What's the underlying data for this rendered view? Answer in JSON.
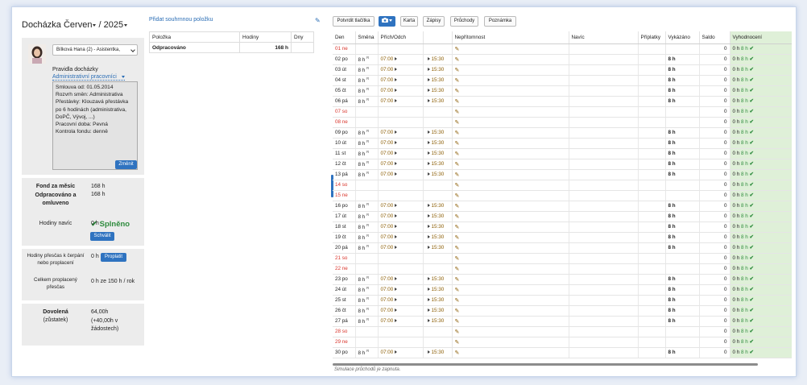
{
  "header": {
    "title": "Docházka Červen",
    "separator": "/",
    "year": "2025"
  },
  "employee": {
    "selected": "Bílková Hana (2) - Asistentka,",
    "rules_label": "Pravidla docházky",
    "rules_value": "Administrativní pracovníci",
    "info_lines": [
      "Smlouva od: 01.05.2014",
      "Rozvrh směn: Administrativa",
      "Přestávky: Klouzavá přestávka po 6 hodinách (administrativa, DoPČ, Vývoj, ...)",
      "Pracovní doba: Pevná",
      "Kontrola fondu: denně"
    ],
    "change_button": "Změnit"
  },
  "fund": {
    "fund_label": "Fond za měsíc",
    "fund_value": "168 h",
    "worked_label": "Odpracováno a omluveno",
    "worked_value": "168 h",
    "status": "Splněno",
    "extra_label": "Hodiny navíc",
    "extra_value": "0 h",
    "approve_button": "Schválit"
  },
  "overtime": {
    "label": "Hodiny přesčas k čerpání nebo proplacení",
    "value": "0 h",
    "pay_button": "Proplatit",
    "total_label": "Celkem proplacený přesčas",
    "total_value": "0 h ze 150 h / rok"
  },
  "vacation": {
    "label": "Dovolená",
    "sublabel": "(zůstatek)",
    "value": "64,00h",
    "pending": "(+40,00h v žádostech)"
  },
  "summary": {
    "add_link": "Přidat souhrnnou položku",
    "columns": [
      "Položka",
      "Hodiny",
      "Dny"
    ],
    "rows": [
      {
        "item": "Odpracováno",
        "hours": "168 h",
        "days": ""
      }
    ]
  },
  "toolbar": {
    "confirm": "Potvrdit tlačítka",
    "karta": "Karta",
    "zapisy": "Zápisy",
    "pruchody": "Průchody",
    "poznamka": "Poznámka"
  },
  "grid": {
    "columns": [
      "Den",
      "Směna",
      "Přích/Odch",
      "Nepřítomnost",
      "Navíc",
      "Příplatky",
      "Vykázáno",
      "Saldo",
      "Vyhodnocení"
    ],
    "shift_mark": "R",
    "arrival": "07:00",
    "departure": "15:30",
    "shift_hours": "8 h",
    "reported": "8 h",
    "saldo": "0",
    "eval_hours": "0 h",
    "eval_ok": "8 h",
    "days": [
      {
        "d": "01",
        "w": "ne",
        "we": true
      },
      {
        "d": "02",
        "w": "po",
        "we": false
      },
      {
        "d": "03",
        "w": "út",
        "we": false
      },
      {
        "d": "04",
        "w": "st",
        "we": false
      },
      {
        "d": "05",
        "w": "čt",
        "we": false
      },
      {
        "d": "06",
        "w": "pá",
        "we": false
      },
      {
        "d": "07",
        "w": "so",
        "we": true
      },
      {
        "d": "08",
        "w": "ne",
        "we": true
      },
      {
        "d": "09",
        "w": "po",
        "we": false
      },
      {
        "d": "10",
        "w": "út",
        "we": false
      },
      {
        "d": "11",
        "w": "st",
        "we": false
      },
      {
        "d": "12",
        "w": "čt",
        "we": false
      },
      {
        "d": "13",
        "w": "pá",
        "we": false
      },
      {
        "d": "14",
        "w": "so",
        "we": true
      },
      {
        "d": "15",
        "w": "ne",
        "we": true
      },
      {
        "d": "16",
        "w": "po",
        "we": false
      },
      {
        "d": "17",
        "w": "út",
        "we": false
      },
      {
        "d": "18",
        "w": "st",
        "we": false
      },
      {
        "d": "19",
        "w": "čt",
        "we": false
      },
      {
        "d": "20",
        "w": "pá",
        "we": false
      },
      {
        "d": "21",
        "w": "so",
        "we": true
      },
      {
        "d": "22",
        "w": "ne",
        "we": true
      },
      {
        "d": "23",
        "w": "po",
        "we": false
      },
      {
        "d": "24",
        "w": "út",
        "we": false
      },
      {
        "d": "25",
        "w": "st",
        "we": false
      },
      {
        "d": "26",
        "w": "čt",
        "we": false
      },
      {
        "d": "27",
        "w": "pá",
        "we": false
      },
      {
        "d": "28",
        "w": "so",
        "we": true
      },
      {
        "d": "29",
        "w": "ne",
        "we": true
      },
      {
        "d": "30",
        "w": "po",
        "we": false
      }
    ]
  },
  "footer": {
    "simulation_note": "Simulace průchodů je zapnuta."
  },
  "colors": {
    "accent": "#2f73c0",
    "weekend": "#d9342b",
    "ok": "#2e8b3d",
    "eval_bg": "#dff0d8"
  }
}
